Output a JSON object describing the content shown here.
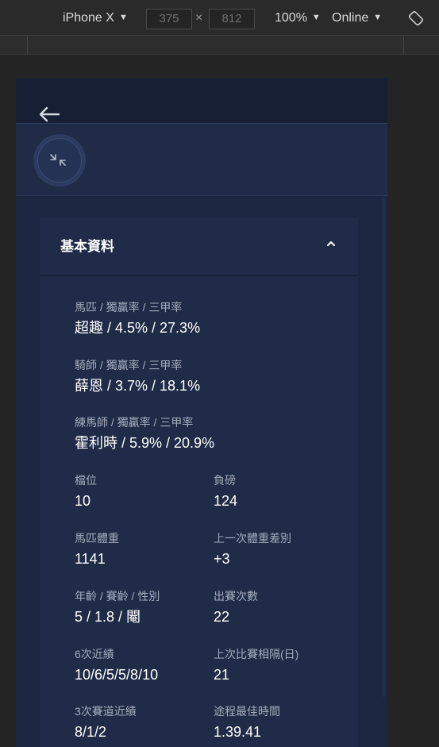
{
  "devtools": {
    "device": "iPhone X",
    "width": "375",
    "height": "812",
    "times": "×",
    "zoom": "100%",
    "network": "Online",
    "icons": {
      "caret": "caret-down-icon",
      "rotate": "rotate-icon"
    }
  },
  "app": {
    "icons": {
      "back": "arrow-left-icon",
      "collapse": "collapse-arrows-icon",
      "chevron": "chevron-up-icon"
    },
    "section": {
      "title": "基本資料",
      "fields": [
        {
          "label": "馬匹 / 獨贏率 / 三甲率",
          "value": "超趣 / 4.5% / 27.3%"
        },
        {
          "label": "騎師 / 獨贏率 / 三甲率",
          "value": "薛恩 / 3.7% / 18.1%"
        },
        {
          "label": "練馬師 / 獨贏率 / 三甲率",
          "value": "霍利時 / 5.9% / 20.9%"
        },
        {
          "label": "檔位",
          "value": "10"
        },
        {
          "label": "負磅",
          "value": "124"
        },
        {
          "label": "馬匹體重",
          "value": "1141"
        },
        {
          "label": "上一次體重差別",
          "value": "+3"
        },
        {
          "label": "年齡 / 賽齡 / 性別",
          "value": "5 / 1.8 / 閹"
        },
        {
          "label": "出賽次數",
          "value": "22"
        },
        {
          "label": "6次近績",
          "value": "10/6/5/5/8/10"
        },
        {
          "label": "上次比賽相隔(日)",
          "value": "21"
        },
        {
          "label": "3次賽道近績",
          "value": "8/1/2"
        },
        {
          "label": "途程最佳時間",
          "value": "1.39.41"
        }
      ]
    }
  }
}
